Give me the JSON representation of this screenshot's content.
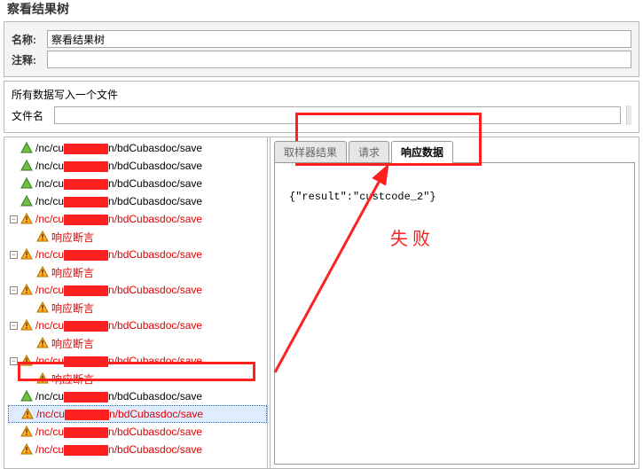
{
  "dialog": {
    "title": "察看结果树"
  },
  "form": {
    "name_label": "名称:",
    "name_value": "察看结果树",
    "comment_label": "注释:",
    "comment_value": ""
  },
  "file": {
    "title": "所有数据写入一个文件",
    "label": "文件名",
    "value": ""
  },
  "tabs": {
    "sampler": "取样器结果",
    "request": "请求",
    "response": "响应数据"
  },
  "response": {
    "body": "{\"result\":\"custcode_2\"}"
  },
  "annotation": {
    "fail_label": "失 败"
  },
  "tree": {
    "prefix": "/nc/cu",
    "suffix": "n/bdCubasdoc/save",
    "assert_label": "响应断言",
    "toggle_open": "−",
    "toggle_closed": "+"
  },
  "tree_nodes": [
    {
      "status": "success",
      "fail": false,
      "children": []
    },
    {
      "status": "success",
      "fail": false,
      "children": []
    },
    {
      "status": "success",
      "fail": false,
      "children": []
    },
    {
      "status": "success",
      "fail": false,
      "children": []
    },
    {
      "status": "warn",
      "fail": true,
      "children": [
        {
          "assert": true
        }
      ]
    },
    {
      "status": "warn",
      "fail": true,
      "children": [
        {
          "assert": true
        }
      ]
    },
    {
      "status": "warn",
      "fail": true,
      "children": [
        {
          "assert": true
        }
      ]
    },
    {
      "status": "warn",
      "fail": true,
      "children": [
        {
          "assert": true
        }
      ]
    },
    {
      "status": "warn",
      "fail": true,
      "children": [
        {
          "assert": true
        }
      ]
    },
    {
      "status": "success",
      "fail": false,
      "children": []
    },
    {
      "status": "warn",
      "fail": true,
      "selected": true,
      "children": []
    },
    {
      "status": "warn",
      "fail": true,
      "children": []
    },
    {
      "status": "warn",
      "fail": true,
      "children": []
    }
  ]
}
